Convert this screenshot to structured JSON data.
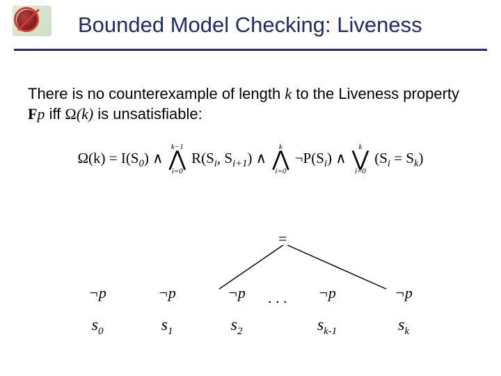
{
  "header": {
    "title": "Bounded Model Checking: Liveness",
    "logo_alt": "no-bugs logo"
  },
  "statement": {
    "prefix": "There is no counterexample of length ",
    "k": "k",
    "mid1": " to the Liveness property ",
    "Fp_F": "F",
    "Fp_p": "p",
    "mid2": " iff ",
    "omega": "Ω",
    "omega_arg": "(k)",
    "suffix": " is unsatisfiable:"
  },
  "formula": {
    "lhs": "Ω(k) = I(S",
    "lhs_sub": "0",
    "lhs_close": ") ∧",
    "and1_top": "k−1",
    "and1_bot": "i=0",
    "term1": "R(S",
    "term1_a": "i",
    "term1_mid": ", S",
    "term1_b": "i+1",
    "term1_close": ") ∧",
    "and2_top": "k",
    "and2_bot": "i=0",
    "term2_neg": "¬P(S",
    "term2_sub": "i",
    "term2_close": ") ∧",
    "or_top": "k",
    "or_bot": "i=0",
    "term3_open": "(S",
    "term3_a": "i",
    "term3_eq": " = S",
    "term3_b": "k",
    "term3_close": ")"
  },
  "diagram": {
    "equals": "=",
    "notp": "¬p",
    "ellipsis": ". . .",
    "labels": {
      "s0_name": "s",
      "s0_sub": "0",
      "s1_name": "s",
      "s1_sub": "1",
      "s2_name": "s",
      "s2_sub": "2",
      "skm1_name": "s",
      "skm1_sub": "k-1",
      "sk_name": "s",
      "sk_sub": "k"
    }
  }
}
